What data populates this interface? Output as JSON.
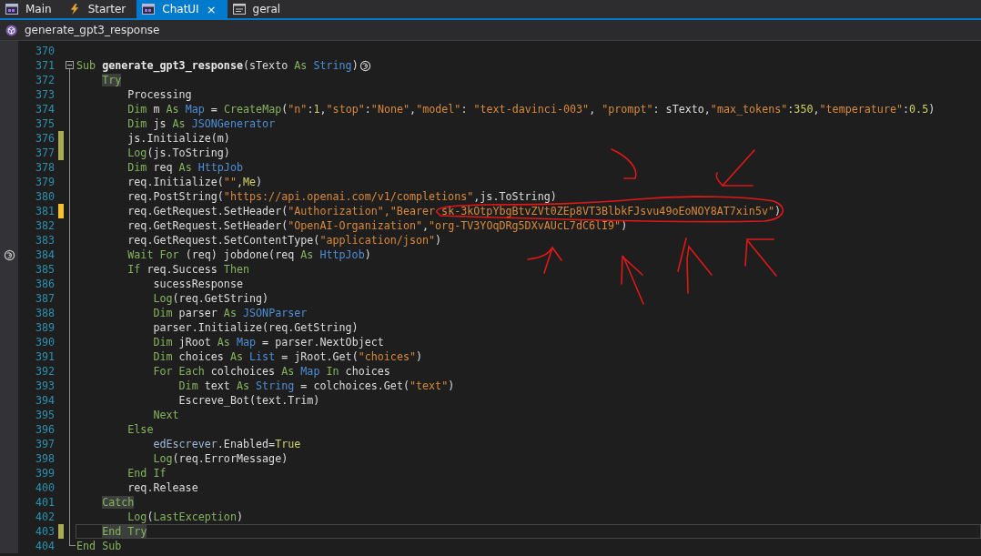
{
  "tabs": [
    {
      "label": "Main",
      "kind": "form",
      "selected": false
    },
    {
      "label": "Starter",
      "kind": "service",
      "selected": false
    },
    {
      "label": "ChatUI",
      "kind": "form",
      "selected": true,
      "close_glyph": "×"
    },
    {
      "label": "geral",
      "kind": "module",
      "selected": false
    }
  ],
  "breadcrumb": {
    "label": "generate_gpt3_response"
  },
  "lines": [
    {
      "number": "370"
    },
    {
      "number": "371",
      "fold_start": true,
      "trailing_icon": true,
      "tokens": [
        {
          "kind": "keyword",
          "text": "Sub "
        },
        {
          "kind": "name",
          "text": "generate_gpt3_response"
        },
        {
          "kind": "plain",
          "text": "(sTexto "
        },
        {
          "kind": "keyword",
          "text": "As "
        },
        {
          "kind": "type",
          "text": "String"
        },
        {
          "kind": "plain",
          "text": ")"
        }
      ]
    },
    {
      "number": "372",
      "tokens": [
        {
          "kind": "highlight",
          "text": "    Try"
        }
      ]
    },
    {
      "number": "373",
      "tokens": [
        {
          "kind": "plain",
          "text": "        Processing"
        }
      ]
    },
    {
      "number": "374",
      "tokens": [
        {
          "kind": "keyword",
          "text": "        Dim"
        },
        {
          "kind": "plain",
          "text": " m "
        },
        {
          "kind": "keyword",
          "text": "As "
        },
        {
          "kind": "type",
          "text": "Map"
        },
        {
          "kind": "plain",
          "text": " = "
        },
        {
          "kind": "keyword",
          "text": "CreateMap"
        },
        {
          "kind": "plain",
          "text": "("
        },
        {
          "kind": "string",
          "text": "\"n\""
        },
        {
          "kind": "plain",
          "text": ":"
        },
        {
          "kind": "number",
          "text": "1"
        },
        {
          "kind": "plain",
          "text": ","
        },
        {
          "kind": "string",
          "text": "\"stop\""
        },
        {
          "kind": "plain",
          "text": ":"
        },
        {
          "kind": "string",
          "text": "\"None\""
        },
        {
          "kind": "plain",
          "text": ","
        },
        {
          "kind": "string",
          "text": "\"model\""
        },
        {
          "kind": "plain",
          "text": ": "
        },
        {
          "kind": "string",
          "text": "\"text-davinci-003\""
        },
        {
          "kind": "plain",
          "text": ", "
        },
        {
          "kind": "string",
          "text": "\"prompt\""
        },
        {
          "kind": "plain",
          "text": ": sTexto,"
        },
        {
          "kind": "string",
          "text": "\"max_tokens\""
        },
        {
          "kind": "plain",
          "text": ":"
        },
        {
          "kind": "number",
          "text": "350"
        },
        {
          "kind": "plain",
          "text": ","
        },
        {
          "kind": "string",
          "text": "\"temperature\""
        },
        {
          "kind": "plain",
          "text": ":"
        },
        {
          "kind": "number",
          "text": "0.5"
        },
        {
          "kind": "plain",
          "text": ")"
        }
      ]
    },
    {
      "number": "375",
      "tokens": [
        {
          "kind": "keyword",
          "text": "        Dim"
        },
        {
          "kind": "plain",
          "text": " js "
        },
        {
          "kind": "keyword",
          "text": "As "
        },
        {
          "kind": "type",
          "text": "JSONGenerator"
        }
      ]
    },
    {
      "number": "376",
      "saved": true,
      "tokens": [
        {
          "kind": "plain",
          "text": "        js.Initialize(m)"
        }
      ]
    },
    {
      "number": "377",
      "saved": true,
      "tokens": [
        {
          "kind": "keyword",
          "text": "        Log"
        },
        {
          "kind": "plain",
          "text": "(js.ToString)"
        }
      ]
    },
    {
      "number": "378",
      "tokens": [
        {
          "kind": "keyword",
          "text": "        Dim"
        },
        {
          "kind": "plain",
          "text": " req "
        },
        {
          "kind": "keyword",
          "text": "As "
        },
        {
          "kind": "type",
          "text": "HttpJob"
        }
      ]
    },
    {
      "number": "379",
      "tokens": [
        {
          "kind": "plain",
          "text": "        req.Initialize("
        },
        {
          "kind": "string",
          "text": "\"\""
        },
        {
          "kind": "plain",
          "text": ","
        },
        {
          "kind": "number",
          "text": "Me"
        },
        {
          "kind": "plain",
          "text": ")"
        }
      ]
    },
    {
      "number": "380",
      "tokens": [
        {
          "kind": "plain",
          "text": "        req.PostString("
        },
        {
          "kind": "string",
          "text": "\"https://api.openai.com/v1/completions\""
        },
        {
          "kind": "plain",
          "text": ",js.ToString)"
        }
      ]
    },
    {
      "number": "381",
      "saved": false,
      "tokens": [
        {
          "kind": "plain",
          "text": "        req.GetRequest.SetHeader("
        },
        {
          "kind": "string",
          "text": "\"Authorization\","
        },
        {
          "kind": "string",
          "text": "\"Bearer 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\""
        },
        {
          "kind": "plain",
          "text": ")"
        }
      ]
    },
    {
      "number": "382",
      "tokens": [
        {
          "kind": "plain",
          "text": "        req.GetRequest.SetHeader("
        },
        {
          "kind": "string",
          "text": "\"OpenAI-Organization\""
        },
        {
          "kind": "plain",
          "text": ","
        },
        {
          "kind": "string",
          "text": "\"org-TV3YOqDRg5DXvAUcL7dC6lI9\""
        },
        {
          "kind": "plain",
          "text": ")"
        }
      ]
    },
    {
      "number": "383",
      "tokens": [
        {
          "kind": "plain",
          "text": "        req.GetRequest.SetContentType("
        },
        {
          "kind": "string",
          "text": "\"application/json\""
        },
        {
          "kind": "plain",
          "text": ")"
        }
      ]
    },
    {
      "number": "384",
      "margin_icon": true,
      "tokens": [
        {
          "kind": "keyword",
          "text": "        Wait For"
        },
        {
          "kind": "plain",
          "text": " (req) jobdone(req "
        },
        {
          "kind": "keyword",
          "text": "As "
        },
        {
          "kind": "type",
          "text": "HttpJob"
        },
        {
          "kind": "plain",
          "text": ")"
        }
      ]
    },
    {
      "number": "385",
      "tokens": [
        {
          "kind": "keyword",
          "text": "        If"
        },
        {
          "kind": "plain",
          "text": " req.Success "
        },
        {
          "kind": "keyword",
          "text": "Then"
        }
      ]
    },
    {
      "number": "386",
      "tokens": [
        {
          "kind": "plain",
          "text": "            sucessResponse"
        }
      ]
    },
    {
      "number": "387",
      "tokens": [
        {
          "kind": "keyword",
          "text": "            Log"
        },
        {
          "kind": "plain",
          "text": "(req.GetString)"
        }
      ]
    },
    {
      "number": "388",
      "tokens": [
        {
          "kind": "keyword",
          "text": "            Dim"
        },
        {
          "kind": "plain",
          "text": " parser "
        },
        {
          "kind": "keyword",
          "text": "As "
        },
        {
          "kind": "type",
          "text": "JSONParser"
        }
      ]
    },
    {
      "number": "389",
      "tokens": [
        {
          "kind": "plain",
          "text": "            parser.Initialize(req.GetString)"
        }
      ]
    },
    {
      "number": "390",
      "tokens": [
        {
          "kind": "keyword",
          "text": "            Dim"
        },
        {
          "kind": "plain",
          "text": " jRoot "
        },
        {
          "kind": "keyword",
          "text": "As "
        },
        {
          "kind": "type",
          "text": "Map"
        },
        {
          "kind": "plain",
          "text": " = parser.NextObject"
        }
      ]
    },
    {
      "number": "391",
      "tokens": [
        {
          "kind": "keyword",
          "text": "            Dim"
        },
        {
          "kind": "plain",
          "text": " choices "
        },
        {
          "kind": "keyword",
          "text": "As "
        },
        {
          "kind": "type",
          "text": "List"
        },
        {
          "kind": "plain",
          "text": " = jRoot.Get("
        },
        {
          "kind": "string",
          "text": "\"choices\""
        },
        {
          "kind": "plain",
          "text": ")"
        }
      ]
    },
    {
      "number": "392",
      "tokens": [
        {
          "kind": "keyword",
          "text": "            For Each"
        },
        {
          "kind": "plain",
          "text": " colchoices "
        },
        {
          "kind": "keyword",
          "text": "As "
        },
        {
          "kind": "type",
          "text": "Map"
        },
        {
          "kind": "keyword",
          "text": " In"
        },
        {
          "kind": "plain",
          "text": " choices"
        }
      ]
    },
    {
      "number": "393",
      "tokens": [
        {
          "kind": "keyword",
          "text": "                Dim"
        },
        {
          "kind": "plain",
          "text": " text "
        },
        {
          "kind": "keyword",
          "text": "As "
        },
        {
          "kind": "type",
          "text": "String"
        },
        {
          "kind": "plain",
          "text": " = colchoices.Get("
        },
        {
          "kind": "string",
          "text": "\"text\""
        },
        {
          "kind": "plain",
          "text": ")"
        }
      ]
    },
    {
      "number": "394",
      "tokens": [
        {
          "kind": "plain",
          "text": "                Escreve_Bot(text.Trim)"
        }
      ]
    },
    {
      "number": "395",
      "tokens": [
        {
          "kind": "keyword",
          "text": "            Next"
        }
      ]
    },
    {
      "number": "396",
      "tokens": [
        {
          "kind": "keyword",
          "text": "        Else"
        }
      ]
    },
    {
      "number": "397",
      "tokens": [
        {
          "kind": "variable",
          "text": "            edEscrever"
        },
        {
          "kind": "plain",
          "text": ".Enabled="
        },
        {
          "kind": "number",
          "text": "True"
        }
      ]
    },
    {
      "number": "398",
      "tokens": [
        {
          "kind": "keyword",
          "text": "            Log"
        },
        {
          "kind": "plain",
          "text": "(req.ErrorMessage)"
        }
      ]
    },
    {
      "number": "399",
      "tokens": [
        {
          "kind": "keyword",
          "text": "        End If"
        }
      ]
    },
    {
      "number": "400",
      "tokens": [
        {
          "kind": "plain",
          "text": "        req.Release"
        }
      ]
    },
    {
      "number": "401",
      "tokens": [
        {
          "kind": "highlight",
          "text": "    Catch"
        }
      ]
    },
    {
      "number": "402",
      "tokens": [
        {
          "kind": "keyword",
          "text": "        Log"
        },
        {
          "kind": "plain",
          "text": "("
        },
        {
          "kind": "keyword",
          "text": "LastException"
        },
        {
          "kind": "plain",
          "text": ")"
        }
      ]
    },
    {
      "number": "403",
      "saved": true,
      "current": true,
      "tokens": [
        {
          "kind": "highlight",
          "text": "    End Try"
        }
      ]
    },
    {
      "number": "404",
      "fold_end": true,
      "tokens": [
        {
          "kind": "keyword",
          "text": "End Sub"
        }
      ]
    }
  ]
}
